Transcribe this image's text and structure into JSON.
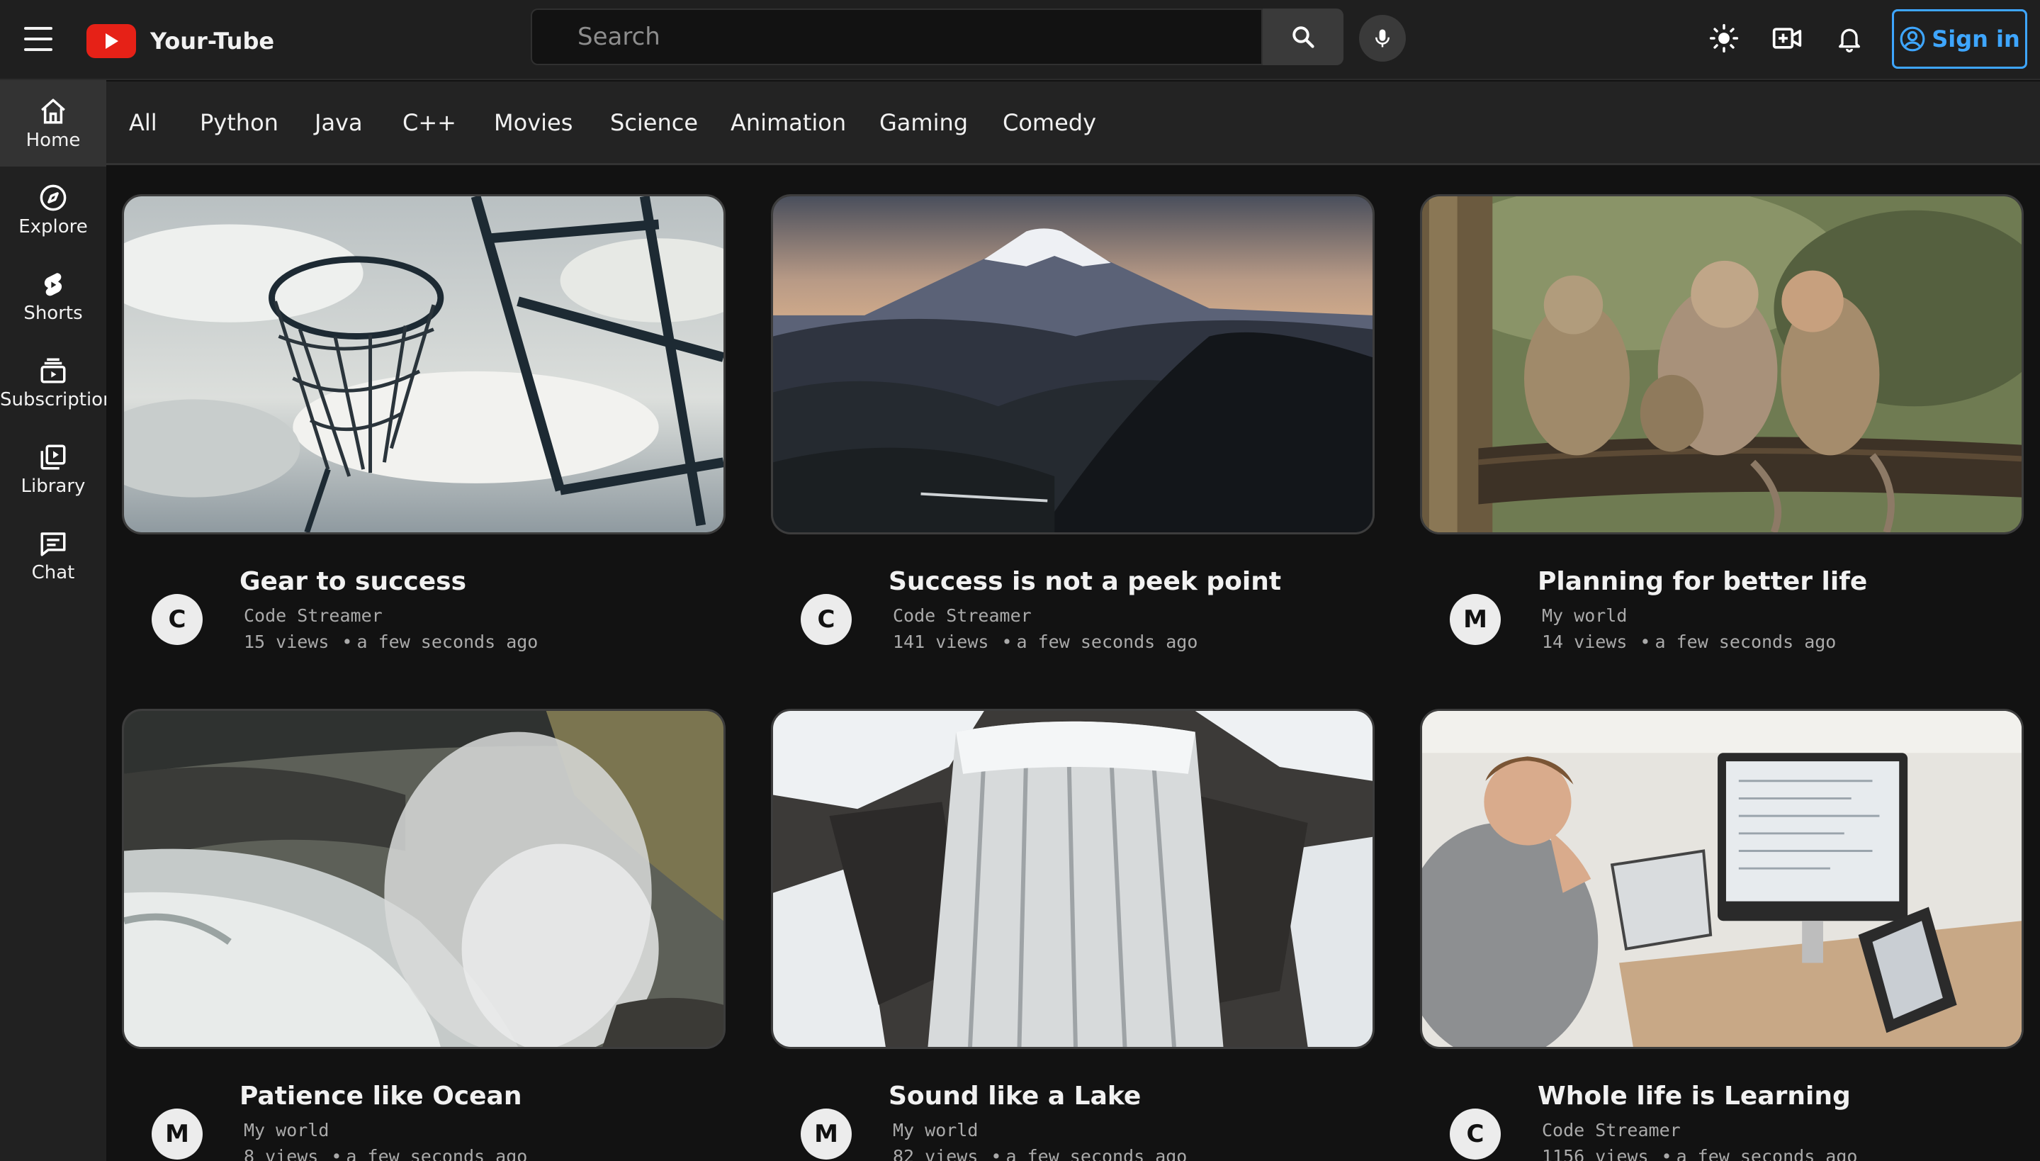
{
  "header": {
    "brand": "Your-Tube",
    "search_placeholder": "Search",
    "signin_label": "Sign in",
    "icons": [
      "menu-icon",
      "youtube-logo",
      "search-icon",
      "mic-icon",
      "theme-sun-icon",
      "create-video-icon",
      "bell-icon",
      "user-circle-icon"
    ],
    "accent_color": "#3ea6ff",
    "logo_color": "#e62117"
  },
  "sidebar": {
    "items": [
      {
        "label": "Home",
        "icon": "home-icon",
        "active": true
      },
      {
        "label": "Explore",
        "icon": "compass-icon"
      },
      {
        "label": "Shorts",
        "icon": "shorts-icon"
      },
      {
        "label": "Subscriptions",
        "icon": "subscriptions-icon"
      },
      {
        "label": "Library",
        "icon": "library-icon"
      },
      {
        "label": "Chat",
        "icon": "chat-icon"
      }
    ]
  },
  "chips": [
    "All",
    "Python",
    "Java",
    "C++",
    "Movies",
    "Science",
    "Animation",
    "Gaming",
    "Comedy"
  ],
  "videos": [
    {
      "title": "Gear to success",
      "channel": "Code Streamer",
      "avatar": "C",
      "views": "15 views",
      "time": "a few seconds ago",
      "thumbnail": "basketball-hoop-sky"
    },
    {
      "title": "Success is not a peek point",
      "channel": "Code Streamer",
      "avatar": "C",
      "views": "141 views",
      "time": "a few seconds ago",
      "thumbnail": "mount-fuji-sunset"
    },
    {
      "title": "Planning for better life",
      "channel": "My world",
      "avatar": "M",
      "views": "14 views",
      "time": "a few seconds ago",
      "thumbnail": "baboons-on-log"
    },
    {
      "title": "Patience like Ocean",
      "channel": "My world",
      "avatar": "M",
      "views": "8 views",
      "time": "a few seconds ago",
      "thumbnail": "waterfall-gorge-mist"
    },
    {
      "title": "Sound like a Lake",
      "channel": "My world",
      "avatar": "M",
      "views": "82 views",
      "time": "a few seconds ago",
      "thumbnail": "snowy-waterfall"
    },
    {
      "title": "Whole life is Learning",
      "channel": "Code Streamer",
      "avatar": "C",
      "views": "1156 views",
      "time": "a few seconds ago",
      "thumbnail": "man-coding-at-desk"
    }
  ]
}
